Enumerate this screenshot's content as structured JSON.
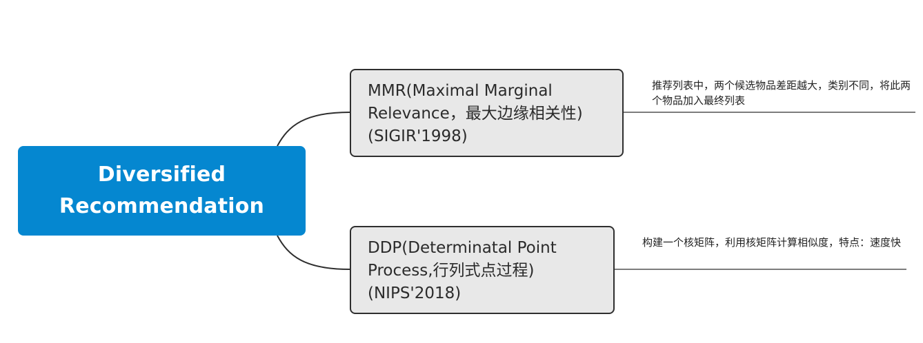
{
  "root": {
    "label": "Diversified Recommendation"
  },
  "branches": [
    {
      "label": "MMR(Maximal Marginal Relevance，最大边缘相关性)(SIGIR'1998)",
      "note": "推荐列表中，两个候选物品差距越大，类别不同，将此两个物品加入最终列表"
    },
    {
      "label": "DDP(Determinatal Point Process,行列式点过程)(NIPS'2018)",
      "note": "构建一个核矩阵，利用核矩阵计算相似度，特点：速度快"
    }
  ],
  "colors": {
    "root_fill": "#0587d0",
    "root_text": "#ffffff",
    "branch_fill": "#e8e8e8",
    "branch_border": "#2e2e2e",
    "line": "#2e2e2e"
  }
}
